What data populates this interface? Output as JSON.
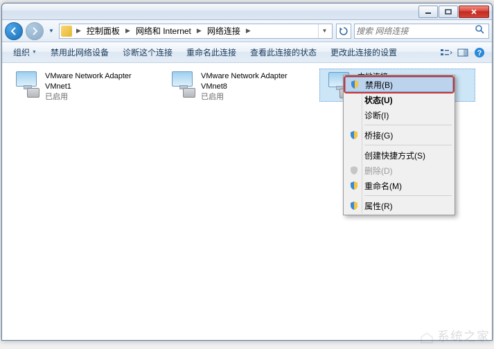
{
  "breadcrumb": {
    "seg1": "控制面板",
    "seg2": "网络和 Internet",
    "seg3": "网络连接"
  },
  "search": {
    "placeholder": "搜索 网络连接"
  },
  "toolbar": {
    "organize": "组织",
    "disable": "禁用此网络设备",
    "diagnose": "诊断这个连接",
    "rename": "重命名此连接",
    "status": "查看此连接的状态",
    "settings": "更改此连接的设置"
  },
  "connections": [
    {
      "name": "VMware Network Adapter VMnet1",
      "status": "已启用"
    },
    {
      "name": "VMware Network Adapter VMnet8",
      "status": "已启用"
    },
    {
      "name": "本地连接",
      "status": ""
    }
  ],
  "ctx": {
    "disable": "禁用(B)",
    "status": "状态(U)",
    "diagnose": "诊断(I)",
    "bridge": "桥接(G)",
    "shortcut": "创建快捷方式(S)",
    "delete": "删除(D)",
    "rename": "重命名(M)",
    "properties": "属性(R)"
  },
  "watermark": "系统之家"
}
